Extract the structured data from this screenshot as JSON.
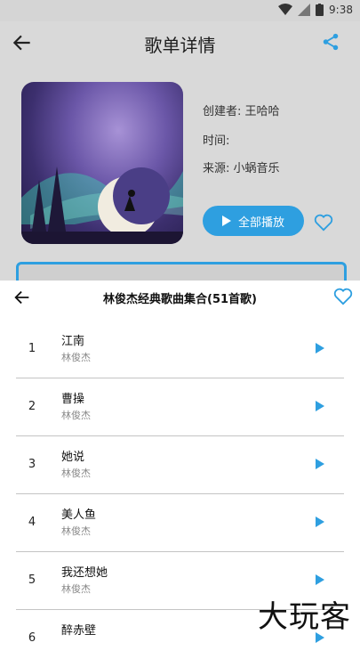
{
  "status": {
    "time": "9:38"
  },
  "header": {
    "title": "歌单详情"
  },
  "playlist": {
    "creator": "创建者: 王哈哈",
    "time": "时间:",
    "source": "来源: 小蜗音乐",
    "play_all_label": "全部播放"
  },
  "sheet": {
    "title": "林俊杰经典歌曲集合(51首歌)"
  },
  "songs": [
    {
      "num": "1",
      "title": "江南",
      "artist": "林俊杰"
    },
    {
      "num": "2",
      "title": "曹操",
      "artist": "林俊杰"
    },
    {
      "num": "3",
      "title": "她说",
      "artist": "林俊杰"
    },
    {
      "num": "4",
      "title": "美人鱼",
      "artist": "林俊杰"
    },
    {
      "num": "5",
      "title": "我还想她",
      "artist": "林俊杰"
    },
    {
      "num": "6",
      "title": "醉赤壁",
      "artist": ""
    }
  ],
  "watermark": "大玩客",
  "colors": {
    "accent": "#2e9fe0"
  }
}
